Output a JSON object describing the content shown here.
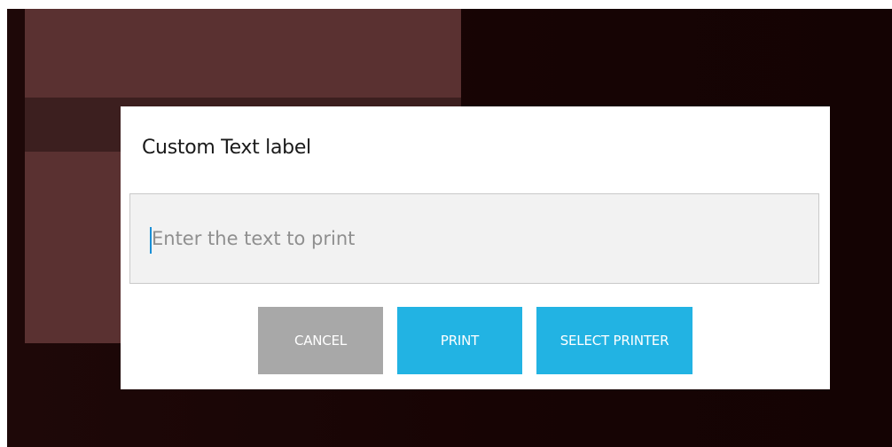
{
  "dialog": {
    "title": "Custom Text label",
    "input": {
      "value": "",
      "placeholder": "Enter the text to print"
    },
    "buttons": {
      "cancel_label": "CANCEL",
      "print_label": "PRINT",
      "select_printer_label": "SELECT PRINTER"
    }
  },
  "colors": {
    "accent": "#22b3e3",
    "cancel": "#a8a8a8",
    "caret": "#1a8fd6",
    "backdrop_panel": "#5a3131",
    "backdrop": "#1a0505"
  }
}
